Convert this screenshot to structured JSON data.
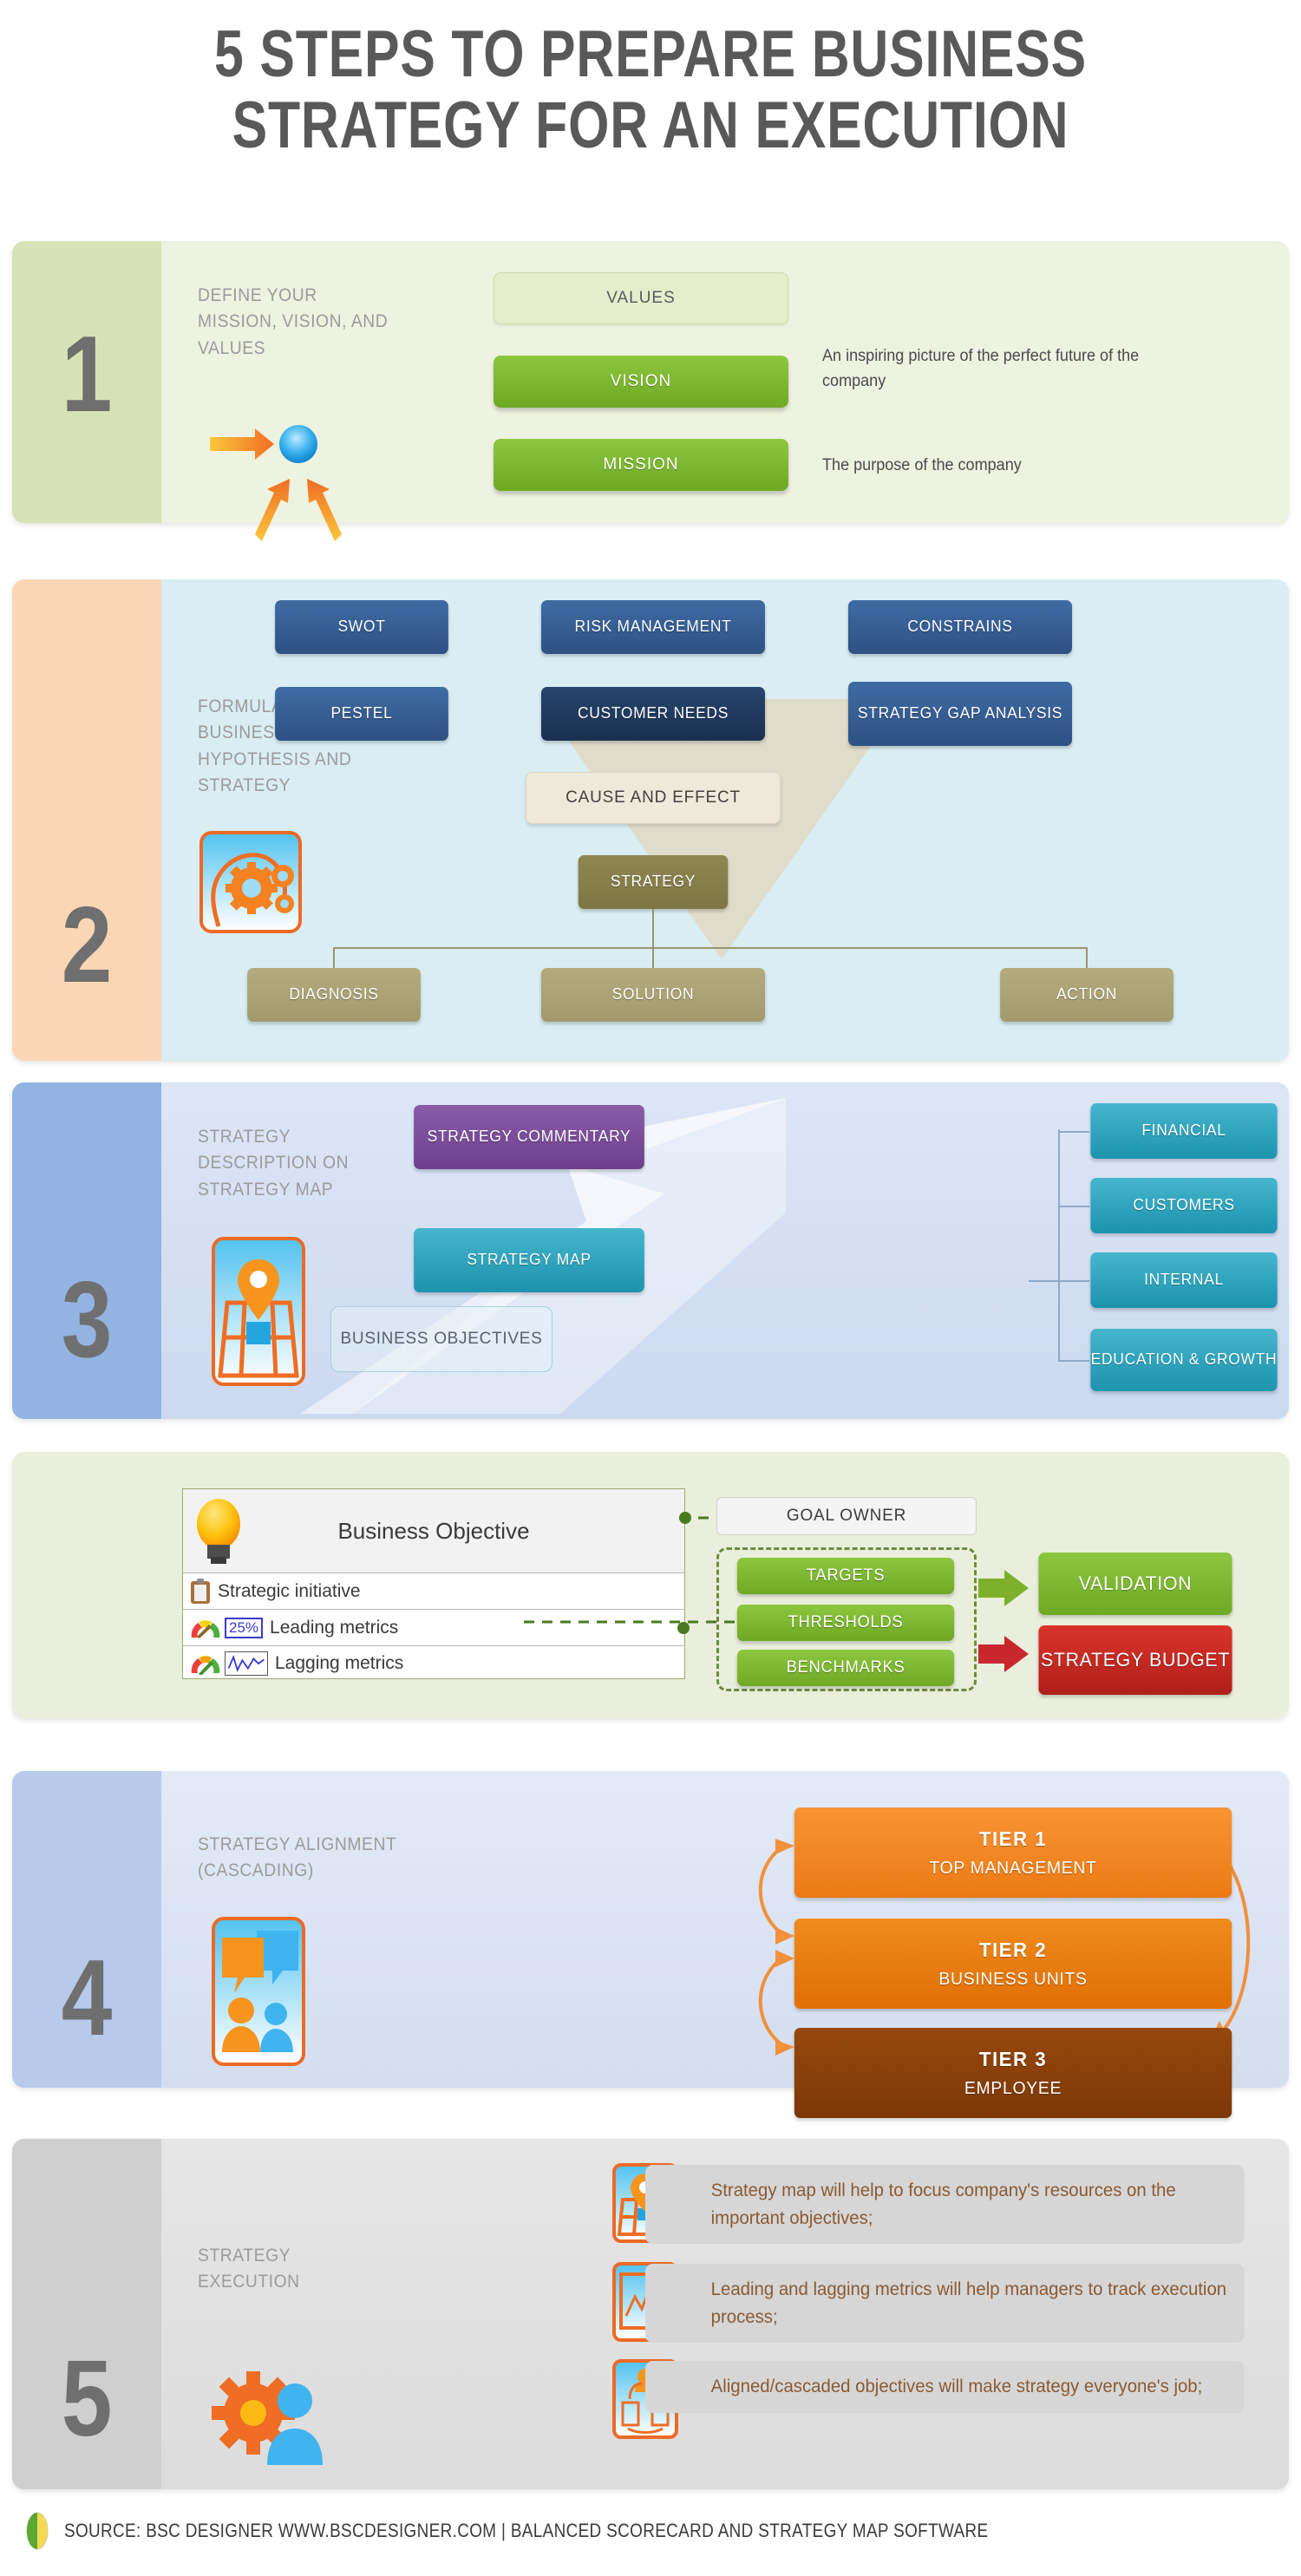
{
  "title": {
    "line1": "5 STEPS TO PREPARE BUSINESS",
    "line2": "STRATEGY FOR AN EXECUTION"
  },
  "steps": [
    {
      "number": "1",
      "label": "DEFINE YOUR\nMISSION, VISION, AND\nVALUES",
      "icon": "target-arrows-icon",
      "boxes": [
        {
          "label": "VALUES",
          "style": "light"
        },
        {
          "label": "VISION",
          "style": "green",
          "desc": "An inspiring picture of the perfect future of the company"
        },
        {
          "label": "MISSION",
          "style": "green",
          "desc": "The purpose of the company"
        }
      ]
    },
    {
      "number": "2",
      "label": "FORMULATING\nBUSINESS\nHYPOTHESIS AND\nSTRATEGY",
      "icon": "head-gears-icon",
      "row1": [
        "SWOT",
        "RISK MANAGEMENT",
        "CONSTRAINS"
      ],
      "row2": [
        "PESTEL",
        "CUSTOMER NEEDS",
        "STRATEGY GAP ANALYSIS"
      ],
      "highlighted": "CUSTOMER NEEDS",
      "cause_effect": "CAUSE AND EFFECT",
      "strategy": "STRATEGY",
      "outputs": [
        "DIAGNOSIS",
        "SOLUTION",
        "ACTION"
      ]
    },
    {
      "number": "3",
      "label": "STRATEGY\nDESCRIPTION ON\nSTRATEGY MAP",
      "icon": "map-pin-icon",
      "commentary": "STRATEGY COMMENTARY",
      "strategy_map": "STRATEGY MAP",
      "business_objectives": "BUSINESS OBJECTIVES",
      "perspectives": [
        "FINANCIAL",
        "CUSTOMERS",
        "INTERNAL",
        "EDUCATION & GROWTH"
      ]
    },
    {
      "number": "4",
      "label": "STRATEGY ALIGNMENT\n(CASCADING)",
      "icon": "people-chat-icon",
      "tiers": [
        {
          "title": "TIER  1",
          "sub": "TOP MANAGEMENT"
        },
        {
          "title": "TIER  2",
          "sub": "BUSINESS UNITS"
        },
        {
          "title": "TIER  3",
          "sub": "EMPLOYEE"
        }
      ]
    },
    {
      "number": "5",
      "label": "STRATEGY\nEXECUTION",
      "icon": "gear-person-icon",
      "bullets": [
        {
          "icon": "strategy-map-icon",
          "text": "Strategy map will help to focus company's resources on the important objectives;"
        },
        {
          "icon": "metrics-chart-icon",
          "text": "Leading and lagging metrics will help managers to track execution process;"
        },
        {
          "icon": "cascade-icon",
          "text": "Aligned/cascaded objectives will make strategy everyone's job;"
        }
      ]
    }
  ],
  "detail": {
    "objective_icon": "lightbulb-icon",
    "objective": "Business Objective",
    "rows": [
      {
        "icon": "clipboard-icon",
        "text": "Strategic initiative"
      },
      {
        "icon": "gauge-icon",
        "badge": "25%",
        "text": "Leading metrics"
      },
      {
        "icon": "gauge-icon",
        "badge_icon": "sparkline-icon",
        "text": "Lagging metrics"
      }
    ],
    "goal_owner": "GOAL OWNER",
    "dashed_group": [
      "TARGETS",
      "THRESHOLDS",
      "BENCHMARKS"
    ],
    "validation": "VALIDATION",
    "budget": "STRATEGY BUDGET"
  },
  "footer": {
    "icon": "bsc-logo-icon",
    "text": "SOURCE: BSC DESIGNER WWW.BSCDESIGNER.COM | BALANCED SCORECARD AND STRATEGY MAP SOFTWARE"
  },
  "colors": {
    "green": "#8dc63f",
    "blue": "#2e5183",
    "dark_blue": "#1b3050",
    "khaki": "#a39a6c",
    "teal": "#1d93ae",
    "purple": "#6e3f8c",
    "orange": "#ec7a14",
    "brown": "#7c3806",
    "red": "#b11f1a",
    "title_gray": "#595959"
  }
}
